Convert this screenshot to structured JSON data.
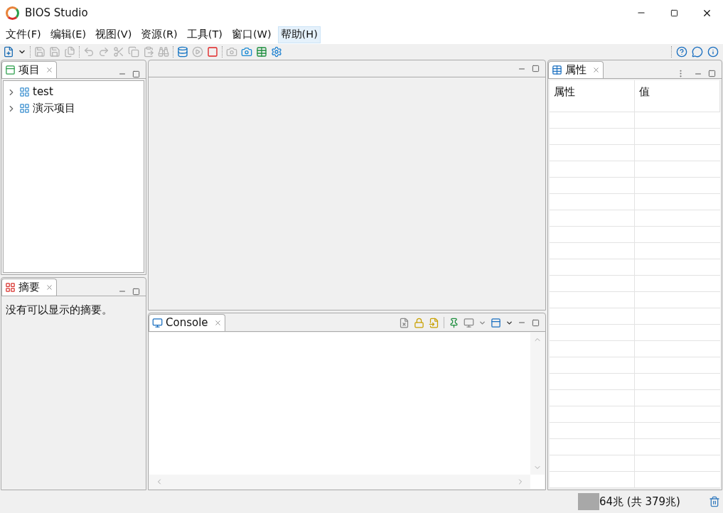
{
  "window": {
    "title": "BIOS Studio"
  },
  "menu": [
    {
      "label": "文件(F)",
      "selected": false
    },
    {
      "label": "编辑(E)",
      "selected": false
    },
    {
      "label": "视图(V)",
      "selected": false
    },
    {
      "label": "资源(R)",
      "selected": false
    },
    {
      "label": "工具(T)",
      "selected": false
    },
    {
      "label": "窗口(W)",
      "selected": false
    },
    {
      "label": "帮助(H)",
      "selected": true
    }
  ],
  "toolbar": [
    {
      "kind": "new",
      "disabled": false
    },
    {
      "kind": "dropdown",
      "disabled": false
    },
    {
      "kind": "sep"
    },
    {
      "kind": "save",
      "disabled": true
    },
    {
      "kind": "saveas",
      "disabled": true
    },
    {
      "kind": "saveall",
      "disabled": true
    },
    {
      "kind": "sep"
    },
    {
      "kind": "undo",
      "disabled": true
    },
    {
      "kind": "redo",
      "disabled": true
    },
    {
      "kind": "cut",
      "disabled": true
    },
    {
      "kind": "copy",
      "disabled": true
    },
    {
      "kind": "paste",
      "disabled": true
    },
    {
      "kind": "find",
      "disabled": true
    },
    {
      "kind": "sep"
    },
    {
      "kind": "database",
      "disabled": false
    },
    {
      "kind": "run",
      "disabled": true
    },
    {
      "kind": "stop",
      "disabled": false
    },
    {
      "kind": "sep"
    },
    {
      "kind": "camera",
      "disabled": true
    },
    {
      "kind": "camera",
      "disabled": false
    },
    {
      "kind": "excel",
      "disabled": false
    },
    {
      "kind": "settings",
      "disabled": false
    }
  ],
  "toolbar_right": [
    {
      "kind": "help"
    },
    {
      "kind": "chat"
    },
    {
      "kind": "info"
    }
  ],
  "projects": {
    "title": "项目",
    "items": [
      {
        "label": "test",
        "expanded": false
      },
      {
        "label": "演示项目",
        "expanded": false
      }
    ]
  },
  "summary": {
    "title": "摘要",
    "message": "没有可以显示的摘要。"
  },
  "console": {
    "title": "Console"
  },
  "properties": {
    "title": "属性",
    "columns": [
      "属性",
      "值"
    ]
  },
  "status": {
    "heap": {
      "level": 0.17,
      "reading": "64兆 (共 379兆)"
    }
  }
}
